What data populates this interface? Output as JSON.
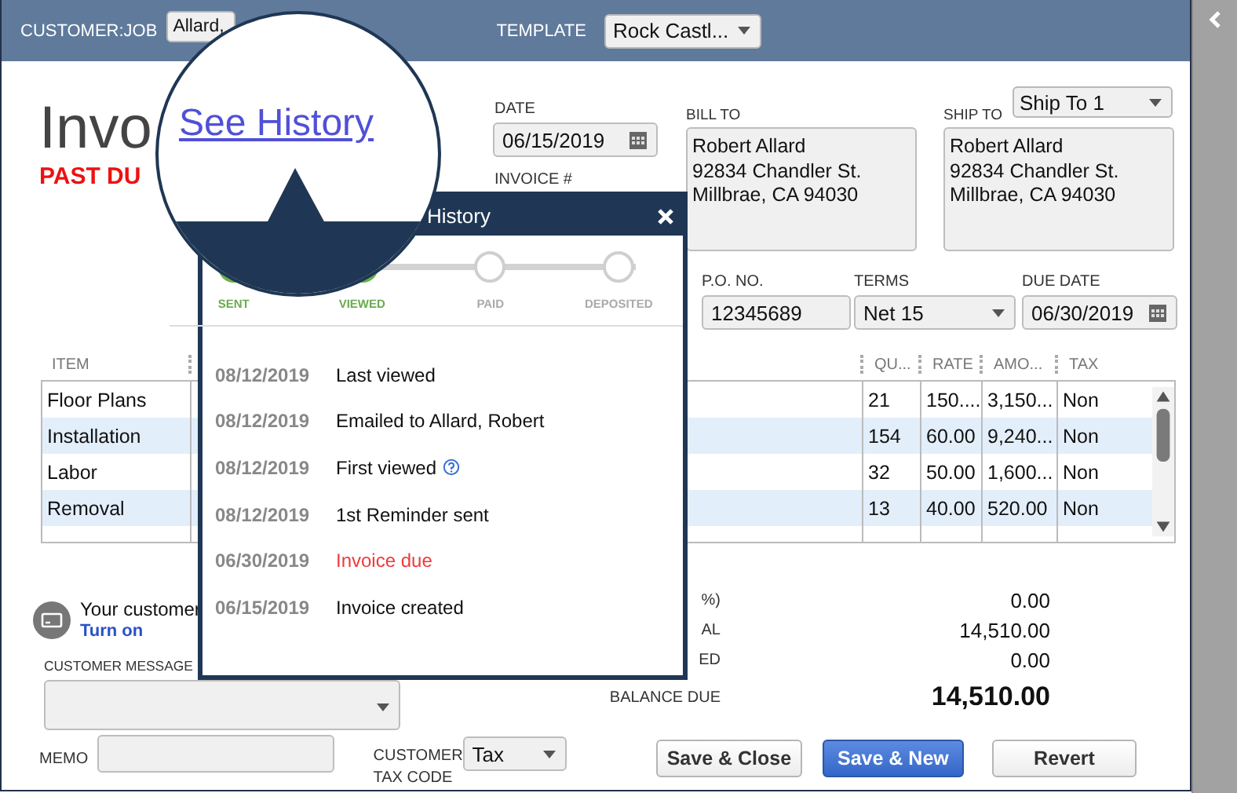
{
  "header": {
    "customer_job_label": "CUSTOMER:JOB",
    "customer_job": "Allard,",
    "template_label": "TEMPLATE",
    "template": "Rock Castl..."
  },
  "form": {
    "title": "Invo",
    "status": "PAST DU",
    "date_label": "DATE",
    "date": "06/15/2019",
    "invoice_no_label": "INVOICE #",
    "bill_to_label": "BILL TO",
    "bill_to": [
      "Robert Allard",
      "92834 Chandler St.",
      "Millbrae, CA 94030"
    ],
    "ship_to_label": "SHIP TO",
    "ship_to_choice": "Ship To 1",
    "ship_to": [
      "Robert Allard",
      "92834 Chandler St.",
      "Millbrae, CA 94030"
    ],
    "po_label": "P.O. NO.",
    "po": "12345689",
    "terms_label": "TERMS",
    "terms": "Net 15",
    "due_date_label": "DUE DATE",
    "due_date": "06/30/2019"
  },
  "table": {
    "columns": [
      "ITEM",
      "QU...",
      "RATE",
      "AMO...",
      "TAX"
    ],
    "rows": [
      {
        "item": "Floor Plans",
        "qty": "21",
        "rate": "150....",
        "amount": "3,150...",
        "tax": "Non"
      },
      {
        "item": "Installation",
        "qty": "154",
        "rate": "60.00",
        "amount": "9,240...",
        "tax": "Non"
      },
      {
        "item": "Labor",
        "qty": "32",
        "rate": "50.00",
        "amount": "1,600...",
        "tax": "Non"
      },
      {
        "item": "Removal",
        "qty": "13",
        "rate": "40.00",
        "amount": "520.00",
        "tax": "Non"
      }
    ]
  },
  "payments": {
    "text": "Your customer",
    "link": "Turn on"
  },
  "customer_message_label": "CUSTOMER MESSAGE",
  "memo_label": "MEMO",
  "tax_code_label": "CUSTOMER TAX CODE",
  "tax_code": "Tax",
  "totals": [
    {
      "label": "%)",
      "value": "0.00",
      "kind": "line"
    },
    {
      "label": "AL",
      "value": "14,510.00",
      "kind": "line"
    },
    {
      "label": "ED",
      "value": "0.00",
      "kind": "line"
    },
    {
      "label": "BALANCE DUE",
      "value": "14,510.00",
      "kind": "balance"
    }
  ],
  "buttons": [
    {
      "label": "Save & Close",
      "kind": "default"
    },
    {
      "label": "Save & New",
      "kind": "primary"
    },
    {
      "label": "Revert",
      "kind": "default"
    }
  ],
  "history": {
    "title": "History",
    "steps": [
      {
        "label": "SENT",
        "done": true
      },
      {
        "label": "VIEWED",
        "done": true
      },
      {
        "label": "PAID",
        "done": false
      },
      {
        "label": "DEPOSITED",
        "done": false
      }
    ],
    "events": [
      {
        "date": "08/12/2019",
        "text": "Last viewed",
        "kind": "normal"
      },
      {
        "date": "08/12/2019",
        "text": "Emailed to Allard, Robert",
        "kind": "normal"
      },
      {
        "date": "08/12/2019",
        "text": "First viewed",
        "kind": "info"
      },
      {
        "date": "08/12/2019",
        "text": "1st Reminder sent",
        "kind": "normal"
      },
      {
        "date": "06/30/2019",
        "text": "Invoice due",
        "kind": "alert"
      },
      {
        "date": "06/15/2019",
        "text": "Invoice created",
        "kind": "normal"
      }
    ]
  },
  "magnifier": {
    "link": "See History"
  }
}
